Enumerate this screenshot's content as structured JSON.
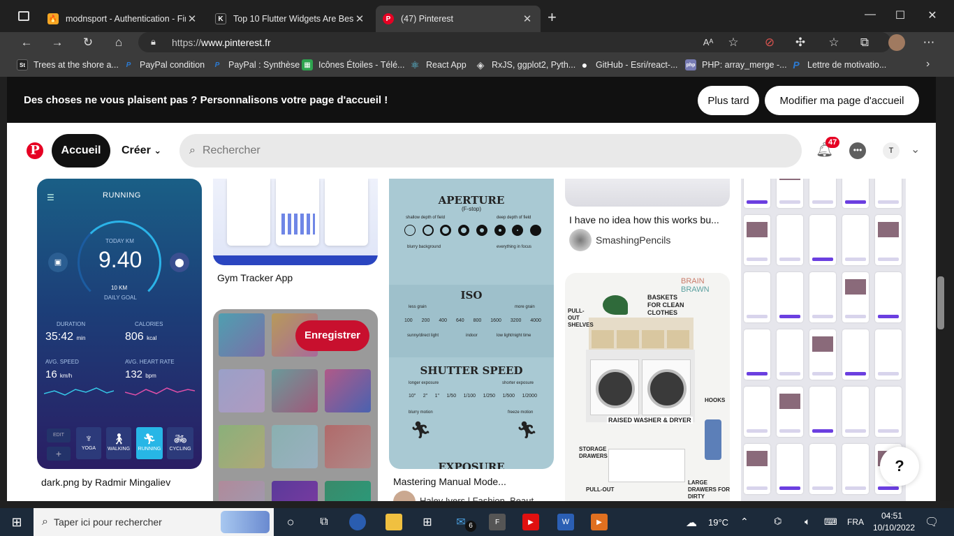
{
  "browser": {
    "tabs": [
      {
        "title": "modnsport - Authentication - Fir",
        "icon": "firebase-icon"
      },
      {
        "title": "Top 10 Flutter Widgets Are Best",
        "icon": "k-icon"
      },
      {
        "title": "(47) Pinterest",
        "icon": "pinterest-icon"
      }
    ],
    "url_proto": "https://",
    "url_host": "www.pinterest.fr",
    "bookmarks": [
      {
        "label": "Trees at the shore a...",
        "badge": "St"
      },
      {
        "label": "PayPal condition",
        "badge": "P"
      },
      {
        "label": "PayPal : Synthèse",
        "badge": "P"
      },
      {
        "label": "Icônes Étoiles - Télé...",
        "badge": "▦"
      },
      {
        "label": "React App",
        "badge": "⚛"
      },
      {
        "label": "RxJS, ggplot2, Pyth...",
        "badge": "◈"
      },
      {
        "label": "GitHub - Esri/react-...",
        "badge": "●"
      },
      {
        "label": "PHP: array_merge -...",
        "badge": "php"
      },
      {
        "label": "Lettre de motivatio...",
        "badge": "P"
      }
    ]
  },
  "banner": {
    "text": "Des choses ne vous plaisent pas ? Personnalisons votre page d'accueil !",
    "later": "Plus tard",
    "edit": "Modifier ma page d'accueil"
  },
  "header": {
    "home": "Accueil",
    "create": "Créer",
    "search_placeholder": "Rechercher",
    "notif_count": "47",
    "avatar_initial": "T"
  },
  "pins": {
    "running": {
      "title": "dark.png by Radmir Mingaliev",
      "app_title": "RUNNING",
      "today_label": "TODAY KM",
      "today_value": "9.40",
      "goal_value": "10 KM",
      "goal_label": "DAILY GOAL",
      "duration_label": "DURATION",
      "duration_value": "35:42",
      "duration_unit": "min",
      "calories_label": "CALORIES",
      "calories_value": "806",
      "calories_unit": "kcal",
      "speed_label": "AVG. SPEED",
      "speed_value": "16",
      "speed_unit": "km/h",
      "heart_label": "AVG. HEART RATE",
      "heart_value": "132",
      "heart_unit": "bpm",
      "activities": [
        "YOGA",
        "WALKING",
        "RUNNING",
        "CYCLING"
      ],
      "edit": "EDIT"
    },
    "gym": {
      "title": "Gym Tracker App"
    },
    "gradients": {
      "save": "Enregistrer"
    },
    "photo": {
      "title": "Mastering Manual Mode...",
      "author": "Haley Ivers | Fashion, Beaut...",
      "aperture": "APERTURE",
      "fstop": "(F-stop)",
      "shallow": "shallow depth of field",
      "deep": "deep depth of field",
      "blurry_bg": "blurry background",
      "all_focus": "everything in focus",
      "iso": "ISO",
      "less_grain": "less grain",
      "more_grain": "more grain",
      "iso_values": [
        "100",
        "200",
        "400",
        "640",
        "800",
        "1600",
        "3200",
        "4000"
      ],
      "sunny": "sunny/direct light",
      "indoor": "indoor",
      "lowlight": "low light/night time",
      "shutter": "SHUTTER SPEED",
      "longer": "longer exposure",
      "shorter": "shorter exposure",
      "shutter_values": [
        "10\"",
        "2\"",
        "1\"",
        "1/50",
        "1/100",
        "1/250",
        "1/500",
        "1/2000"
      ],
      "blurry_motion": "blurry motion",
      "freeze": "freeze motion",
      "exposure": "EXPOSURE"
    },
    "smashing": {
      "title": "I have no idea how this works bu...",
      "author": "SmashingPencils"
    },
    "laundry": {
      "brand1": "BRAIN",
      "brand2": "BRAWN",
      "labels": [
        "BASKETS FOR CLEAN CLOTHES",
        "PULL-OUT SHELVES",
        "HOOKS",
        "RAISED WASHER & DRYER",
        "STORAGE DRAWERS",
        "LARGE DRAWERS FOR DIRTY",
        "PULL-OUT"
      ]
    }
  },
  "help": "?",
  "taskbar": {
    "search_placeholder": "Taper ici pour rechercher",
    "weather": "19°C",
    "lang": "FRA",
    "time": "04:51",
    "date": "10/10/2022",
    "mail_badge": "6"
  }
}
